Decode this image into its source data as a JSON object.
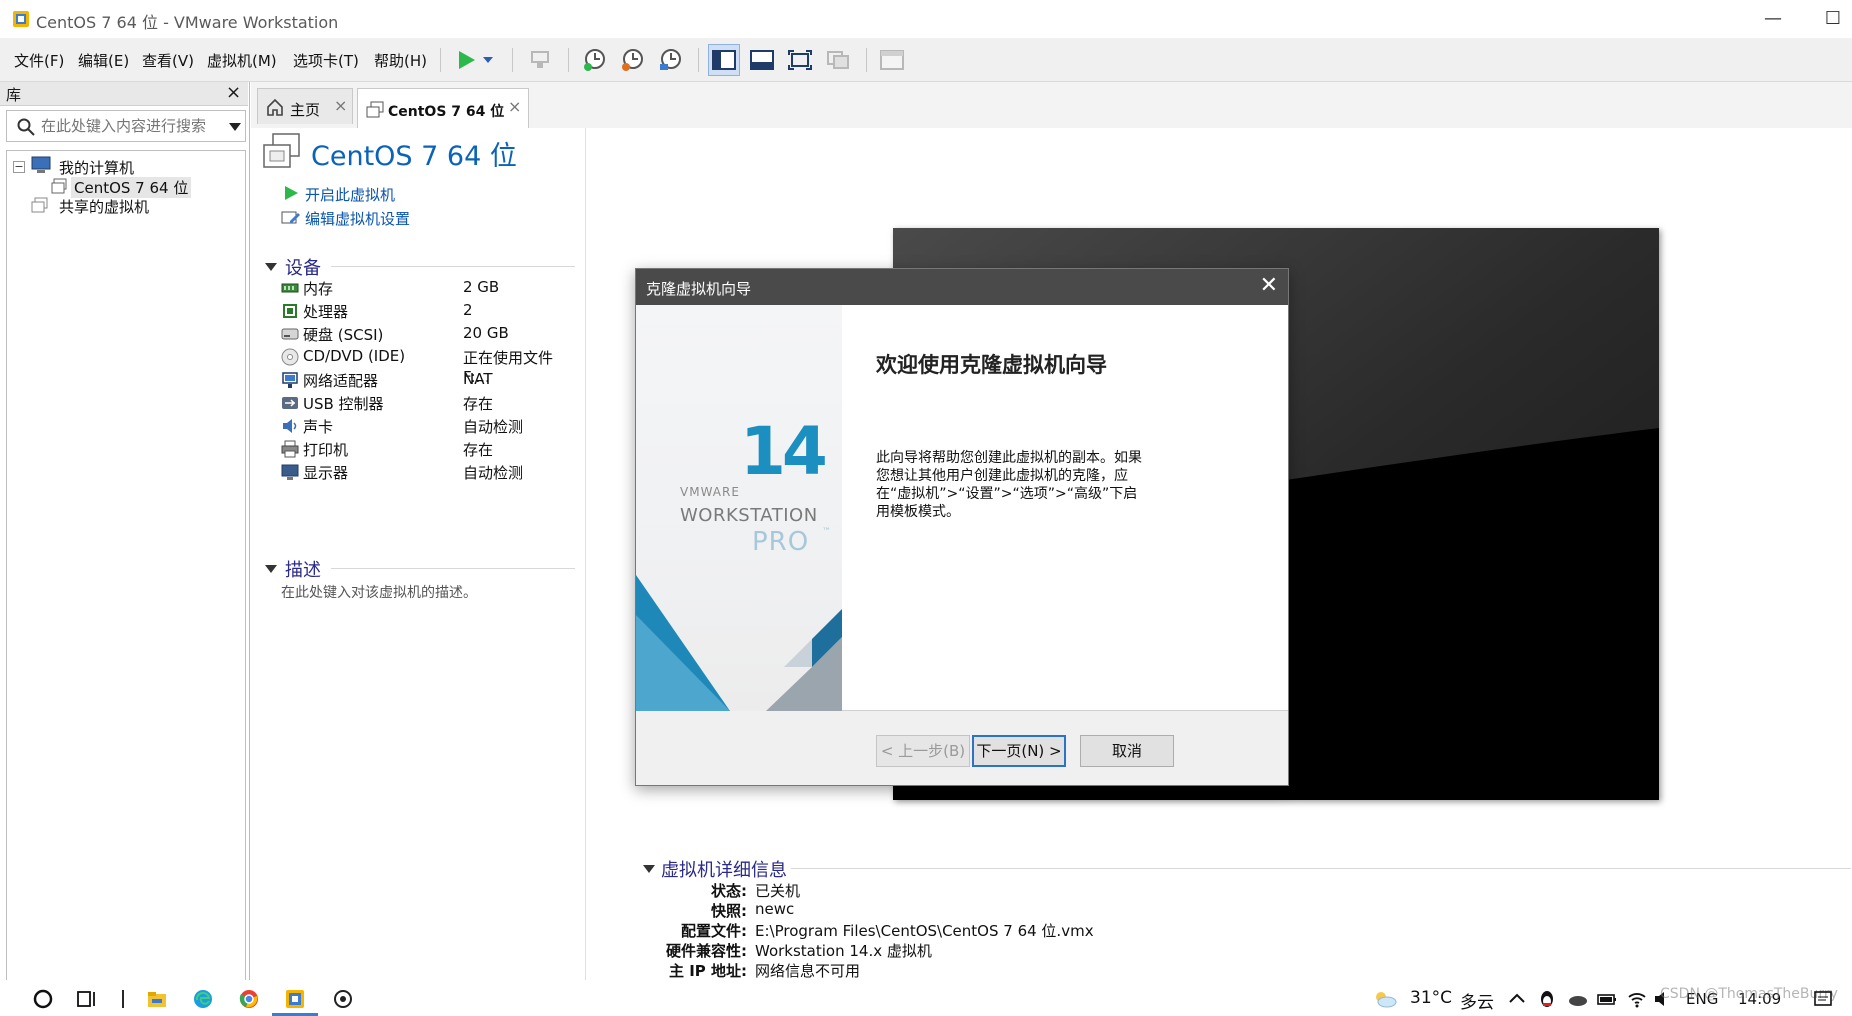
{
  "window": {
    "title": "CentOS 7 64 位 - VMware Workstation",
    "minimize": "—",
    "maximize": "☐"
  },
  "menu": [
    "文件(F)",
    "编辑(E)",
    "查看(V)",
    "虚拟机(M)",
    "选项卡(T)",
    "帮助(H)"
  ],
  "library": {
    "header": "库",
    "close": "×",
    "search_placeholder": "在此处键入内容进行搜索",
    "tree": {
      "collapse": "−",
      "my_computer": "我的计算机",
      "vm": "CentOS 7 64 位",
      "shared": "共享的虚拟机"
    }
  },
  "tabs": [
    {
      "label": "主页",
      "close": "×"
    },
    {
      "label": "CentOS 7 64 位",
      "close": "×"
    }
  ],
  "vm": {
    "title": "CentOS 7 64 位",
    "actions": [
      "开启此虚拟机",
      "编辑虚拟机设置"
    ],
    "devices_header": "设备",
    "devices": [
      {
        "name": "内存",
        "value": "2 GB",
        "icon": "memory-icon"
      },
      {
        "name": "处理器",
        "value": "2",
        "icon": "cpu-icon"
      },
      {
        "name": "硬盘 (SCSI)",
        "value": "20 GB",
        "icon": "harddisk-icon"
      },
      {
        "name": "CD/DVD (IDE)",
        "value": "正在使用文件 F:...",
        "icon": "cd-icon"
      },
      {
        "name": "网络适配器",
        "value": "NAT",
        "icon": "network-icon"
      },
      {
        "name": "USB 控制器",
        "value": "存在",
        "icon": "usb-icon"
      },
      {
        "name": "声卡",
        "value": "自动检测",
        "icon": "sound-icon"
      },
      {
        "name": "打印机",
        "value": "存在",
        "icon": "printer-icon"
      },
      {
        "name": "显示器",
        "value": "自动检测",
        "icon": "display-icon"
      }
    ],
    "description_header": "描述",
    "description_placeholder": "在此处键入对该虚拟机的描述。",
    "details_header": "虚拟机详细信息",
    "details": [
      {
        "key": "状态:",
        "value": "已关机"
      },
      {
        "key": "快照:",
        "value": "newc"
      },
      {
        "key": "配置文件:",
        "value": "E:\\Program Files\\CentOS\\CentOS 7 64 位.vmx"
      },
      {
        "key": "硬件兼容性:",
        "value": "Workstation 14.x 虚拟机"
      },
      {
        "key": "主 IP 地址:",
        "value": "网络信息不可用"
      }
    ]
  },
  "dialog": {
    "title": "克隆虚拟机向导",
    "close": "✕",
    "logo": {
      "number": "14",
      "vmware": "VMWARE",
      "workstation": "WORKSTATION",
      "pro": "PRO",
      "tm": "™"
    },
    "heading": "欢迎使用克隆虚拟机向导",
    "body": "此向导将帮助您创建此虚拟机的副本。如果您想让其他用户创建此虚拟机的克隆，应在“虚拟机”>“设置”>“选项”>“高级”下启用模板模式。",
    "buttons": {
      "back": "< 上一步(B)",
      "next": "下一页(N) >",
      "cancel": "取消"
    }
  },
  "taskbar": {
    "weather_temp": "31°C",
    "weather_text": "多云",
    "lang": "ENG",
    "time": "14:09",
    "watermark": "CSDN @ThomasTheBurry"
  },
  "colors": {
    "accent": "#0a63b8",
    "dialog_title": "#4a4a4a",
    "play": "#2db84b"
  }
}
